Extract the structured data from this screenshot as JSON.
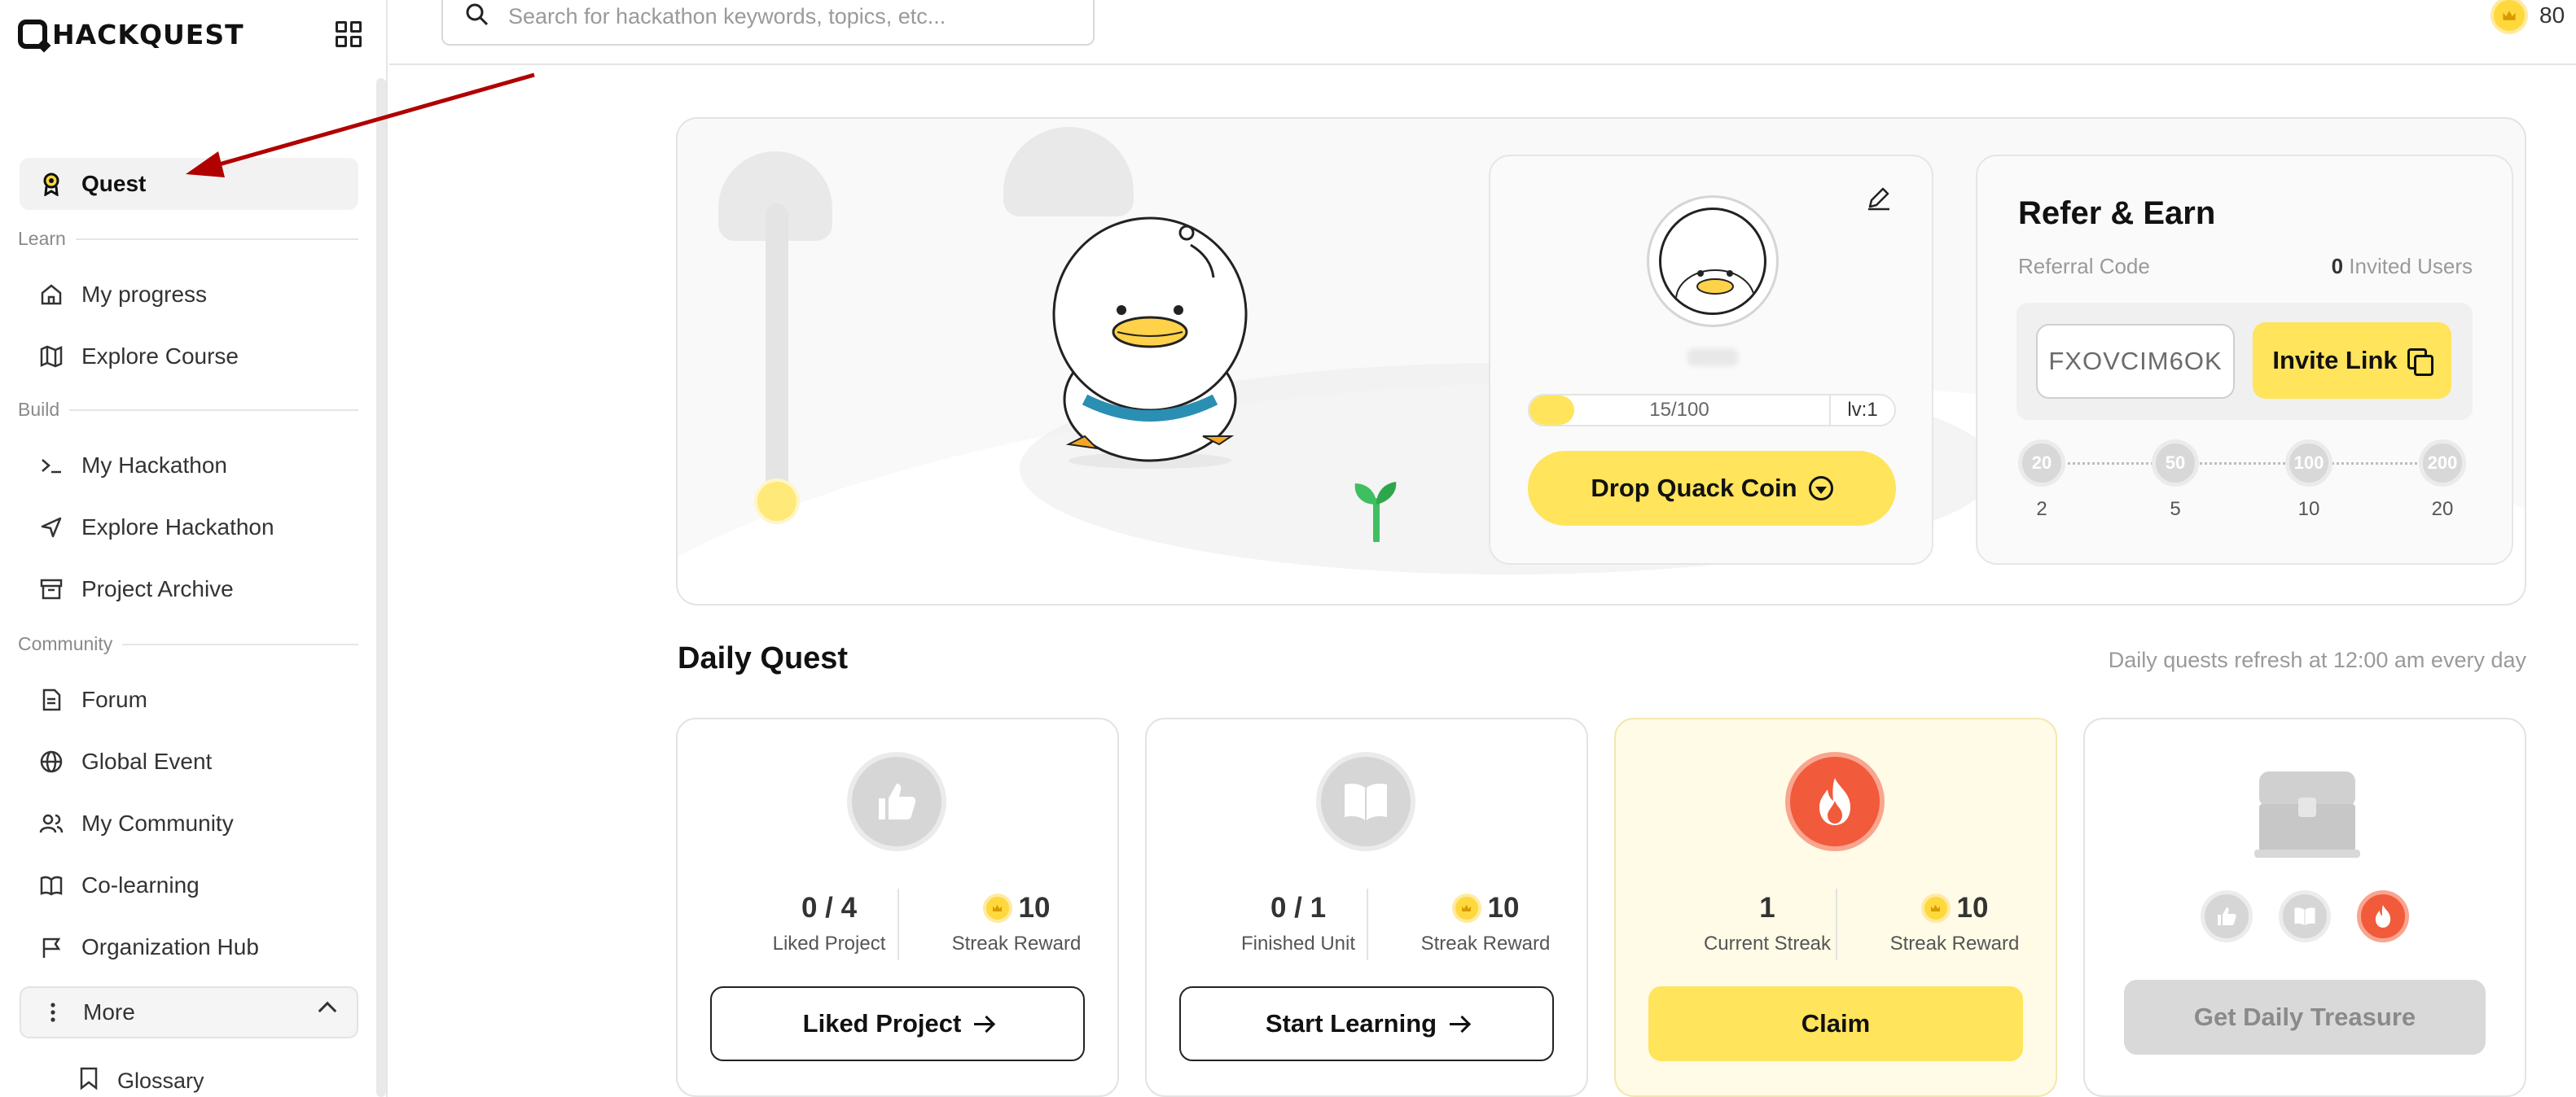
{
  "brand": {
    "logo_text": "HACKQUEST"
  },
  "search": {
    "placeholder": "Search for hackathon keywords, topics, etc..."
  },
  "header": {
    "coin_count": "80"
  },
  "sidebar": {
    "quest_label": "Quest",
    "sections": {
      "learn": "Learn",
      "build": "Build",
      "community": "Community"
    },
    "items": {
      "my_progress": "My progress",
      "explore_course": "Explore Course",
      "my_hackathon": "My Hackathon",
      "explore_hackathon": "Explore Hackathon",
      "project_archive": "Project Archive",
      "forum": "Forum",
      "global_event": "Global Event",
      "my_community": "My Community",
      "co_learning": "Co-learning",
      "organization_hub": "Organization Hub",
      "more": "More",
      "glossary": "Glossary"
    }
  },
  "profile": {
    "progress_text": "15/100",
    "progress_fraction": 0.15,
    "level": "lv:1",
    "drop_button": "Drop Quack Coin"
  },
  "refer": {
    "title": "Refer & Earn",
    "code_label": "Referral Code",
    "invited_count": "0",
    "invited_label": "Invited Users",
    "code": "FXOVCIM6OK",
    "invite_button": "Invite Link",
    "milestones": [
      {
        "reward": "20",
        "users": "2"
      },
      {
        "reward": "50",
        "users": "5"
      },
      {
        "reward": "100",
        "users": "10"
      },
      {
        "reward": "200",
        "users": "20"
      }
    ]
  },
  "daily": {
    "title": "Daily Quest",
    "note": "Daily quests refresh at 12:00 am every day",
    "cards": [
      {
        "stat_value": "0 / 4",
        "stat_label": "Liked Project",
        "reward_value": "10",
        "reward_label": "Streak Reward",
        "button": "Liked Project"
      },
      {
        "stat_value": "0 / 1",
        "stat_label": "Finished Unit",
        "reward_value": "10",
        "reward_label": "Streak Reward",
        "button": "Start Learning"
      },
      {
        "stat_value": "1",
        "stat_label": "Current Streak",
        "reward_value": "10",
        "reward_label": "Streak Reward",
        "button": "Claim"
      }
    ],
    "treasure_button": "Get Daily Treasure"
  },
  "colors": {
    "accent_yellow": "#ffe45c",
    "fire_red": "#f15a3a",
    "annotation_arrow": "#b00000"
  }
}
